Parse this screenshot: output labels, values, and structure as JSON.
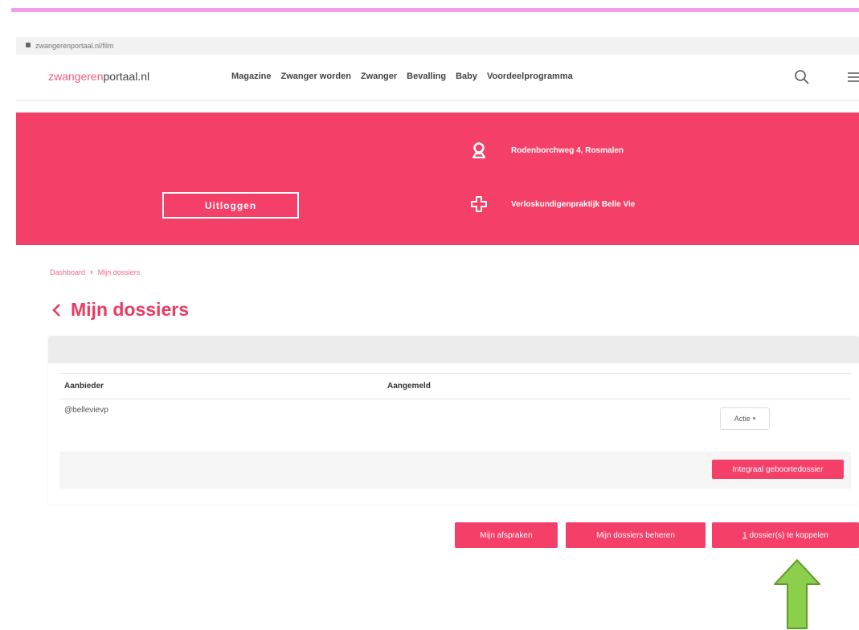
{
  "browser": {
    "url": "zwangerenportaal.nl/film"
  },
  "header": {
    "logo_part1": "zwangeren",
    "logo_part2": "portaal.nl",
    "nav": [
      "Magazine",
      "Zwanger worden",
      "Zwanger",
      "Bevalling",
      "Baby",
      "Voordeelprogramma"
    ]
  },
  "hero": {
    "logout_label": "Uitloggen",
    "address": "Rodenborchweg 4, Rosmalen",
    "practice": "Verloskundigenpraktijk Belle Vie",
    "color": "#f43f68"
  },
  "breadcrumb": {
    "home": "Dashboard",
    "current": "Mijn dossiers"
  },
  "page_title": "Mijn dossiers",
  "table": {
    "columns": [
      "Aanbieder",
      "Aangemeld"
    ],
    "rows": [
      {
        "aanbieder": "@bellevievp",
        "aangemeld": "",
        "action": "Actie"
      }
    ],
    "subrow_button": "Integraal geboortedossier"
  },
  "footer_buttons": {
    "appointments": "Mijn afspraken",
    "manage": "Mijn dossiers beheren",
    "link_count": "1",
    "link_text": " dossier(s) te koppelen"
  },
  "accent_colors": {
    "brand": "#f43f68",
    "stripe": "#f29ee6",
    "arrow": "#8ccf4d"
  }
}
